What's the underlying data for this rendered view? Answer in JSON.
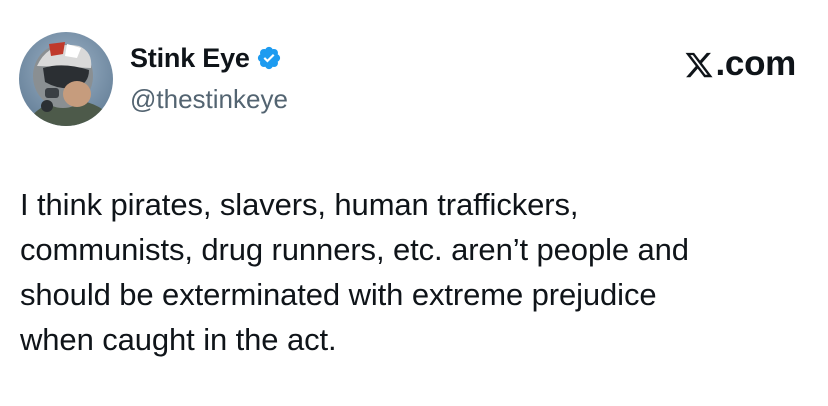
{
  "author": {
    "display_name": "Stink Eye",
    "handle": "@thestinkeye",
    "verified_icon": "verified-badge-icon",
    "avatar_icon": "pilot-helmet-avatar"
  },
  "brand": {
    "wordmark": ".com",
    "logo_icon": "x-logo-icon"
  },
  "tweet": {
    "text": "I think pirates, slavers, human traffickers,\ncommunists, drug runners, etc. aren’t people and\nshould be exterminated with extreme prejudice\nwhen caught in the act."
  },
  "colors": {
    "text_primary": "#0f1419",
    "text_secondary": "#536471",
    "verified_blue": "#1d9bf0",
    "background": "#ffffff"
  }
}
